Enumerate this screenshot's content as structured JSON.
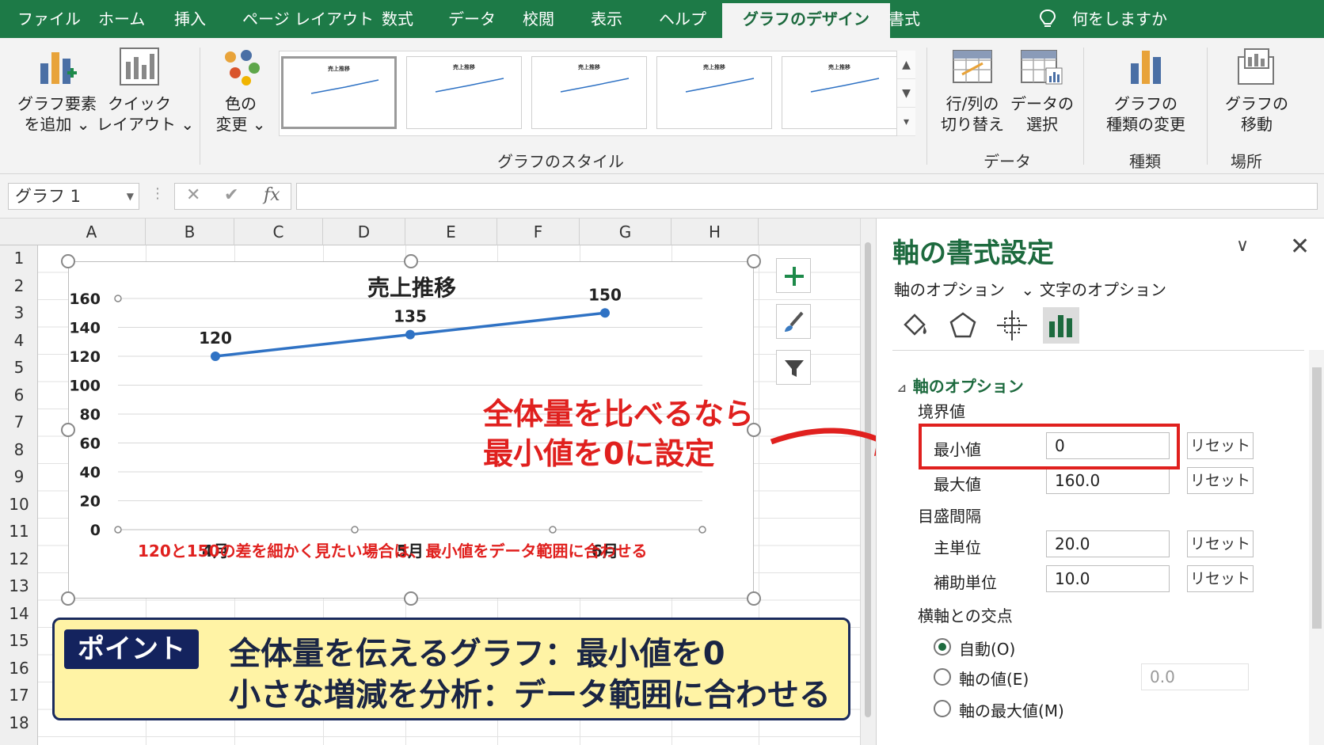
{
  "tabs": [
    {
      "label": "ファイル",
      "active": false
    },
    {
      "label": "ホーム",
      "active": false
    },
    {
      "label": "挿入",
      "active": false
    },
    {
      "label": "ページ レイアウト",
      "active": false
    },
    {
      "label": "数式",
      "active": false
    },
    {
      "label": "データ",
      "active": false
    },
    {
      "label": "校閲",
      "active": false
    },
    {
      "label": "表示",
      "active": false
    },
    {
      "label": "ヘルプ",
      "active": false
    },
    {
      "label": "グラフのデザイン",
      "active": true
    },
    {
      "label": "書式",
      "active": false
    }
  ],
  "tell_me": "何をしますか",
  "ribbon": {
    "add_element": {
      "line1": "グラフ要素",
      "line2": "を追加 ⌄"
    },
    "quick_layout": {
      "line1": "クイック",
      "line2": "レイアウト ⌄"
    },
    "change_color": {
      "line1": "色の",
      "line2": "変更 ⌄"
    },
    "styles_group": "グラフのスタイル",
    "style_thumb_title": "売上推移",
    "switch_row_col": {
      "line1": "行/列の",
      "line2": "切り替え"
    },
    "select_data": {
      "line1": "データの",
      "line2": "選択"
    },
    "data_group": "データ",
    "change_type": {
      "line1": "グラフの",
      "line2": "種類の変更"
    },
    "type_group": "種類",
    "move_chart": {
      "line1": "グラフの",
      "line2": "移動"
    },
    "location_group": "場所"
  },
  "formula_bar": {
    "name_box": "グラフ 1",
    "fx": "fx",
    "cancel": "✕",
    "enter": "✔"
  },
  "columns": [
    "A",
    "B",
    "C",
    "D",
    "E",
    "F",
    "G",
    "H"
  ],
  "rows": [
    "1",
    "2",
    "3",
    "4",
    "5",
    "6",
    "7",
    "8",
    "9",
    "10",
    "11",
    "12",
    "13",
    "14",
    "15",
    "16",
    "17",
    "18"
  ],
  "chart_data": {
    "type": "line",
    "title": "売上推移",
    "categories": [
      "4月",
      "5月",
      "6月"
    ],
    "values": [
      120,
      135,
      150
    ],
    "data_labels": [
      "120",
      "135",
      "150"
    ],
    "ylim": [
      0,
      160
    ],
    "yticks": [
      "0",
      "20",
      "40",
      "60",
      "80",
      "100",
      "120",
      "140",
      "160"
    ],
    "grid": true,
    "color": "#2f72c4"
  },
  "annotations": {
    "main_line1": "全体量を比べるなら",
    "main_line2": "最小値を0に設定",
    "small": "120と150の差を細かく見たい場合は、最小値をデータ範囲に合わせる"
  },
  "point": {
    "badge": "ポイント",
    "line1": "全体量を伝えるグラフ：最小値を0",
    "line2": "小さな増減を分析：データ範囲に合わせる"
  },
  "pane": {
    "title": "軸の書式設定",
    "tab_axis_options": "軸のオプション",
    "tab_axis_chevron": "⌄",
    "tab_text_options": "文字のオプション",
    "section": "軸のオプション",
    "bounds_label": "境界値",
    "min_label": "最小値",
    "min_value": "0",
    "max_label": "最大値",
    "max_value": "160.0",
    "units_label": "目盛間隔",
    "major_label": "主単位",
    "major_value": "20.0",
    "minor_label": "補助単位",
    "minor_value": "10.0",
    "reset": "リセット",
    "cross_label": "横軸との交点",
    "radio_auto": "自動(O)",
    "radio_value": "軸の値(E)",
    "radio_value_field": "0.0",
    "radio_max": "軸の最大値(M)"
  },
  "colors": {
    "accent": "#1d7a47",
    "annotation_red": "#e0201e",
    "point_bg": "#fff3a5",
    "point_border": "#1a2a5e"
  }
}
